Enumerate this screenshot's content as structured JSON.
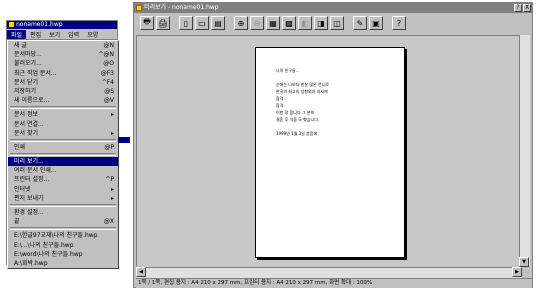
{
  "bg_window": {
    "title": "noname01.hwp",
    "menubar": [
      "파일",
      "편집",
      "보기",
      "입력",
      "모양"
    ],
    "menu_items": [
      {
        "label": "새 글",
        "key": "@N"
      },
      {
        "label": "문서마당...",
        "key": "^@N"
      },
      {
        "label": "불러오기...",
        "key": "@O"
      },
      {
        "label": "최근 작업 문서...",
        "key": "@F3"
      },
      {
        "label": "문서 닫기",
        "key": "^F4"
      },
      {
        "label": "저장하기",
        "key": "@S"
      },
      {
        "label": "새 이름으로...",
        "key": "@V"
      },
      {
        "label": "문서 정보",
        "key": "▸"
      },
      {
        "label": "문서 연결...",
        "key": ""
      },
      {
        "label": "문서 찾기",
        "key": "▸"
      },
      {
        "label": "인쇄",
        "key": "@P"
      },
      {
        "label": "미리 보기...",
        "key": ""
      },
      {
        "label": "여러 문서 인쇄...",
        "key": ""
      },
      {
        "label": "프린터 설정...",
        "key": "^P"
      },
      {
        "label": "인터넷",
        "key": "▸"
      },
      {
        "label": "편지 보내기",
        "key": "▸"
      },
      {
        "label": "환경 설정...",
        "key": ""
      },
      {
        "label": "끝",
        "key": "@X"
      },
      {
        "label": "E:\\한글97교재\\나의 친구들.hwp",
        "key": ""
      },
      {
        "label": "E:\\...\\나의 친구들.hwp",
        "key": ""
      },
      {
        "label": "E:\\word\\나의 친구들.hwp",
        "key": ""
      },
      {
        "label": "A:\\회박.hwp",
        "key": ""
      }
    ]
  },
  "preview": {
    "title": "미리보기 - noname01.hwp",
    "title_buttons": [
      "?",
      "X"
    ],
    "page_lines": [
      "나의 친구들...",
      "",
      "순애는 나보다 한살 많은 언니로",
      "한국의 최고의 성형외과 의사에",
      "합격",
      "합격",
      "이번 정 합니다 그 분의",
      "결혼 후 식을 도 했습니다.",
      "",
      "1999년 1월 3일 씀음에"
    ],
    "status": "1쪽 / 1쪽,  편집 용지 : A4  210 x 297 mm,  프린터 용지 : A4 210 x 297 mm,  화면 확대 : 100%"
  },
  "colors": {
    "selected": "#000080",
    "face": "#c0c0c0",
    "canvas": "#c8c8c8"
  }
}
